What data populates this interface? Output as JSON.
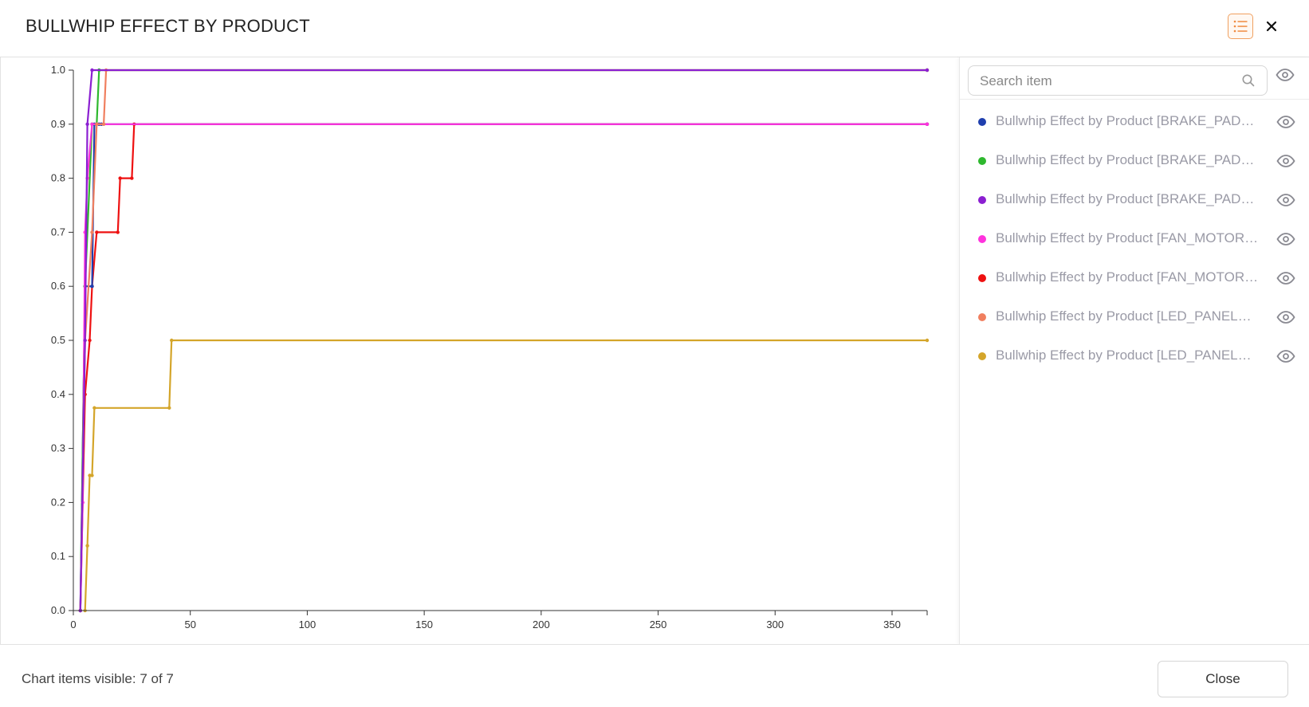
{
  "dialog": {
    "title": "BULLWHIP EFFECT BY PRODUCT"
  },
  "icons": {
    "legend_toggle": "list-icon",
    "close": "close-icon",
    "search": "search-icon",
    "visibility": "eye-icon"
  },
  "colors": {
    "accent": "#f0a060"
  },
  "side_panel": {
    "search_placeholder": "Search item",
    "items": [
      {
        "label": "Bullwhip Effect by Product [BRAKE_PAD_T...",
        "color": "#1f3fae"
      },
      {
        "label": "Bullwhip Effect by Product [BRAKE_PAD_T...",
        "color": "#2eb82e"
      },
      {
        "label": "Bullwhip Effect by Product [BRAKE_PAD_T...",
        "color": "#8b1fd1"
      },
      {
        "label": "Bullwhip Effect by Product [FAN_MOTOR_...",
        "color": "#ff33dd"
      },
      {
        "label": "Bullwhip Effect by Product [FAN_MOTOR_...",
        "color": "#ee1111"
      },
      {
        "label": "Bullwhip Effect by Product [LED_PANEL_T...",
        "color": "#f07f5f"
      },
      {
        "label": "Bullwhip Effect by Product [LED_PANEL_T...",
        "color": "#d4a52a"
      }
    ]
  },
  "footer": {
    "status": "Chart items visible: 7 of 7",
    "close_label": "Close"
  },
  "chart_data": {
    "type": "line",
    "xlim": [
      0,
      365
    ],
    "ylim": [
      0,
      1
    ],
    "x_ticks": [
      0,
      50,
      100,
      150,
      200,
      250,
      300,
      350
    ],
    "x_tick_labels": [
      "0",
      "50",
      "100",
      "150",
      "200",
      "250",
      "300",
      "350"
    ],
    "y_ticks": [
      0,
      0.1,
      0.2,
      0.3,
      0.4,
      0.5,
      0.6,
      0.7,
      0.8,
      0.9,
      1.0
    ],
    "y_tick_labels": [
      "0.0",
      "0.1",
      "0.2",
      "0.3",
      "0.4",
      "0.5",
      "0.6",
      "0.7",
      "0.8",
      "0.9",
      "1.0"
    ],
    "grid": false,
    "series": [
      {
        "color": "#ee1111",
        "x": [
          3,
          5,
          7,
          8,
          10,
          19,
          20,
          25,
          26,
          365
        ],
        "y": [
          0,
          0.4,
          0.5,
          0.6,
          0.7,
          0.7,
          0.8,
          0.8,
          0.9,
          0.9
        ]
      },
      {
        "color": "#1f3fae",
        "x": [
          3,
          5,
          8,
          9,
          11,
          12,
          365
        ],
        "y": [
          0,
          0.6,
          0.6,
          0.9,
          0.9,
          0.9,
          0.9
        ]
      },
      {
        "color": "#d4a52a",
        "x": [
          5,
          6,
          7,
          8,
          9,
          41,
          42,
          365
        ],
        "y": [
          0,
          0.12,
          0.25,
          0.25,
          0.375,
          0.375,
          0.5,
          0.5
        ]
      },
      {
        "color": "#2eb82e",
        "x": [
          3,
          5,
          8,
          10,
          11,
          365
        ],
        "y": [
          0,
          0.6,
          0.9,
          0.9,
          1.0,
          1.0
        ]
      },
      {
        "color": "#ff33dd",
        "x": [
          3,
          4,
          5,
          6,
          8,
          10,
          365
        ],
        "y": [
          0,
          0.2,
          0.7,
          0.8,
          0.9,
          0.9,
          0.9
        ]
      },
      {
        "color": "#f07f5f",
        "x": [
          3,
          5,
          8,
          10,
          13,
          14,
          365
        ],
        "y": [
          0,
          0.5,
          0.7,
          0.9,
          0.9,
          1.0,
          1.0
        ]
      },
      {
        "color": "#8b1fd1",
        "x": [
          3,
          5,
          6,
          8,
          365
        ],
        "y": [
          0,
          0.5,
          0.9,
          1.0,
          1.0
        ]
      }
    ]
  }
}
